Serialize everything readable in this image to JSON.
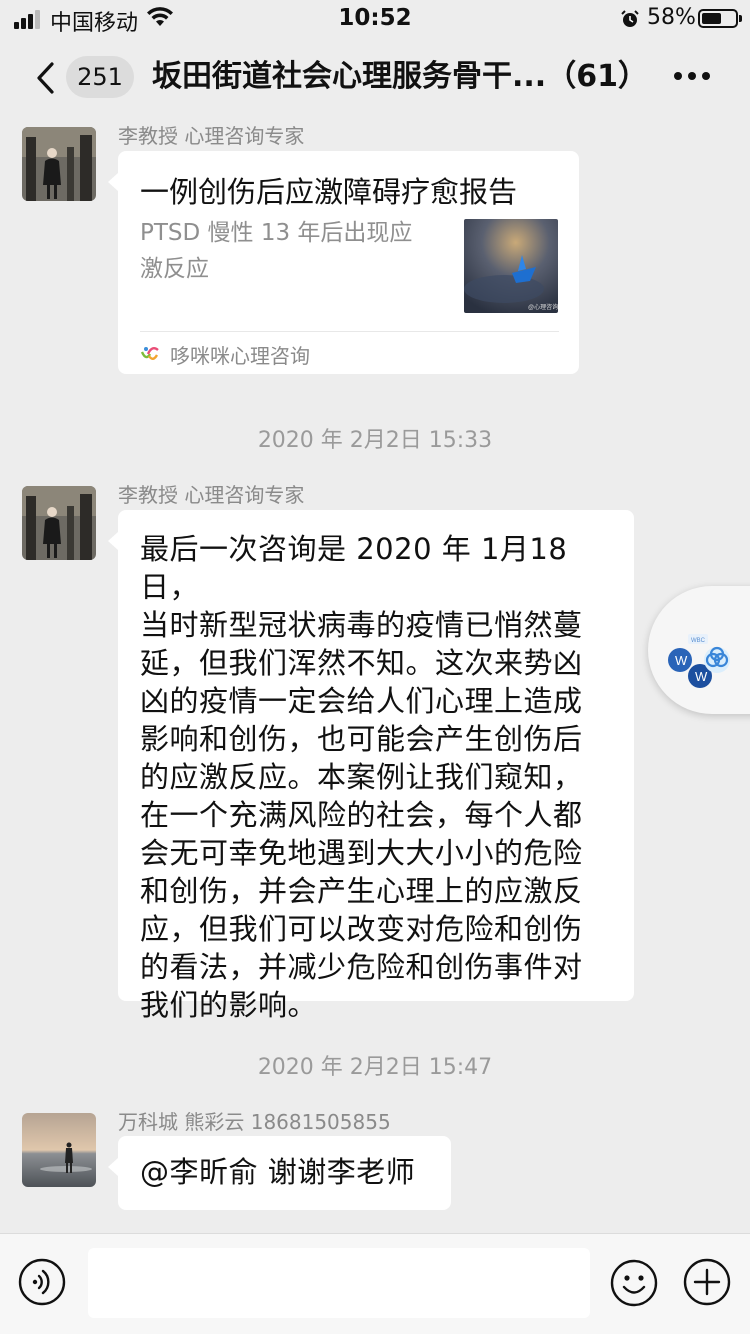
{
  "status_bar": {
    "carrier": "中国移动",
    "time": "10:52",
    "battery_percent": "58%",
    "battery_level": 0.58,
    "icons": [
      "signal-icon",
      "wifi-icon",
      "alarm-icon",
      "battery-icon"
    ]
  },
  "nav": {
    "unread_count": "251",
    "title": "坂田街道社会心理服务骨干...（61）",
    "icons": [
      "back-icon",
      "more-icon"
    ]
  },
  "messages": {
    "m1": {
      "sender": "李教授 心理咨询专家",
      "card_title": "一例创伤后应激障碍疗愈报告",
      "card_desc_line1": "PTSD 慢性 13 年后出现应",
      "card_desc_line2": "激反应",
      "card_source": "哆咪咪心理咨询",
      "thumb_watermark": "@心理咨询"
    },
    "ts1": "2020 年 2月2日 15:33",
    "m2": {
      "sender": "李教授 心理咨询专家",
      "lines": [
        "最后一次咨询是 2020 年 1月18日，",
        "当时新型冠状病毒的疫情已悄然蔓",
        "延，但我们浑然不知。这次来势凶",
        "凶的疫情一定会给人们心理上造成",
        "影响和创伤，也可能会产生创伤后",
        "的应激反应。本案例让我们窥知，",
        "在一个充满风险的社会，每个人都",
        "会无可幸免地遇到大大小小的危险",
        "和创伤，并会产生心理上的应激反",
        "应，但我们可以改变对危险和创伤",
        "的看法，并减少危险和创伤事件对",
        "我们的影响。"
      ]
    },
    "ts2": "2020 年 2月2日 15:47",
    "m3": {
      "sender": "万科城 熊彩云 18681505855",
      "text": "@李昕俞 谢谢李老师"
    }
  },
  "floating_ball": {
    "label": "WBC",
    "icons": [
      "wechat-work-icon"
    ]
  },
  "input_bar": {
    "value": "",
    "icons": [
      "voice-icon",
      "emoji-icon",
      "plus-icon"
    ]
  }
}
